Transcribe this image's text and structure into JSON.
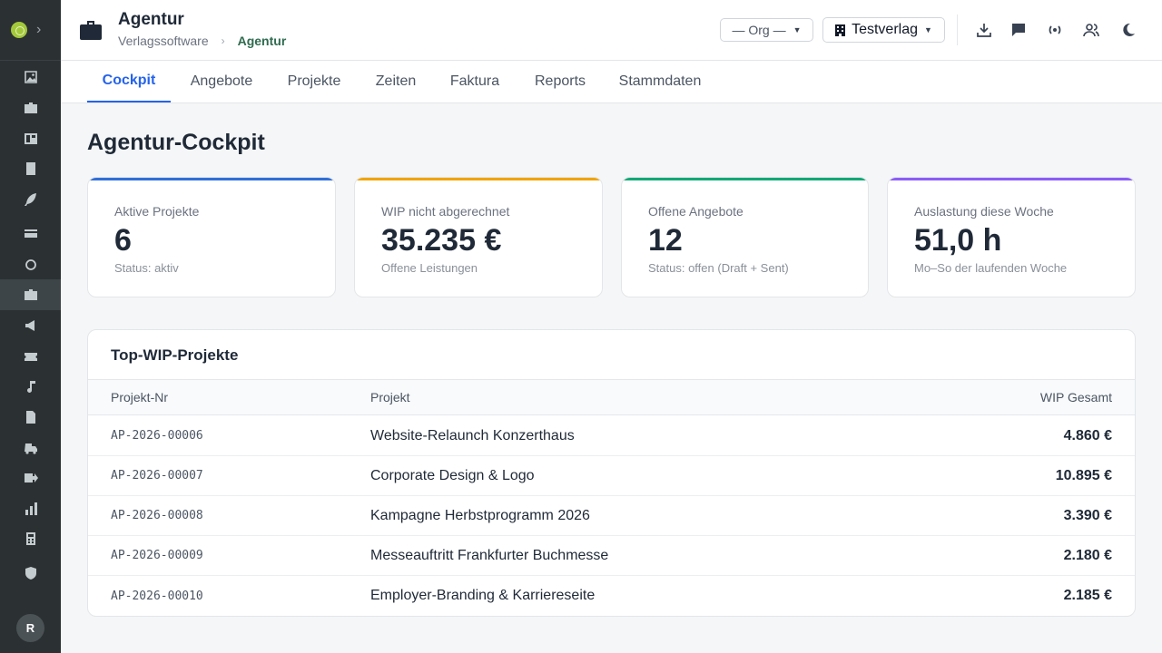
{
  "header": {
    "title": "Agentur",
    "breadcrumb": [
      "Verlagssoftware",
      "Agentur"
    ],
    "breadcrumb_separator": "›",
    "org_select": "— Org —",
    "firm_select": "Testverlag"
  },
  "sidebar": {
    "avatar_initial": "R",
    "items": [
      "image-icon",
      "briefcase-icon",
      "board-icon",
      "book-icon",
      "feather-icon",
      "card-icon",
      "refresh-icon",
      "agency-icon",
      "megaphone-icon",
      "ticket-icon",
      "music-icon",
      "document-icon",
      "truck-icon",
      "export-icon",
      "chart-icon",
      "calculator-icon",
      "shield-icon"
    ]
  },
  "tabs": [
    "Cockpit",
    "Angebote",
    "Projekte",
    "Zeiten",
    "Faktura",
    "Reports",
    "Stammdaten"
  ],
  "active_tab": "Cockpit",
  "page_title": "Agentur-Cockpit",
  "cards": [
    {
      "label": "Aktive Projekte",
      "value": "6",
      "sub": "Status: aktiv",
      "color": "#2f6fd8"
    },
    {
      "label": "WIP nicht abgerechnet",
      "value": "35.235 €",
      "sub": "Offene Leistungen",
      "color": "#f0a500"
    },
    {
      "label": "Offene Angebote",
      "value": "12",
      "sub": "Status: offen (Draft + Sent)",
      "color": "#12a876"
    },
    {
      "label": "Auslastung diese Woche",
      "value": "51,0 h",
      "sub": "Mo–So der laufenden Woche",
      "color": "#8b5cf6"
    }
  ],
  "table": {
    "title": "Top-WIP-Projekte",
    "columns": [
      "Projekt-Nr",
      "Projekt",
      "WIP Gesamt"
    ],
    "rows": [
      [
        "AP-2026-00006",
        "Website-Relaunch Konzerthaus",
        "4.860 €"
      ],
      [
        "AP-2026-00007",
        "Corporate Design & Logo",
        "10.895 €"
      ],
      [
        "AP-2026-00008",
        "Kampagne Herbstprogramm 2026",
        "3.390 €"
      ],
      [
        "AP-2026-00009",
        "Messeauftritt Frankfurter Buchmesse",
        "2.180 €"
      ],
      [
        "AP-2026-00010",
        "Employer-Branding & Karriereseite",
        "2.185 €"
      ]
    ]
  }
}
